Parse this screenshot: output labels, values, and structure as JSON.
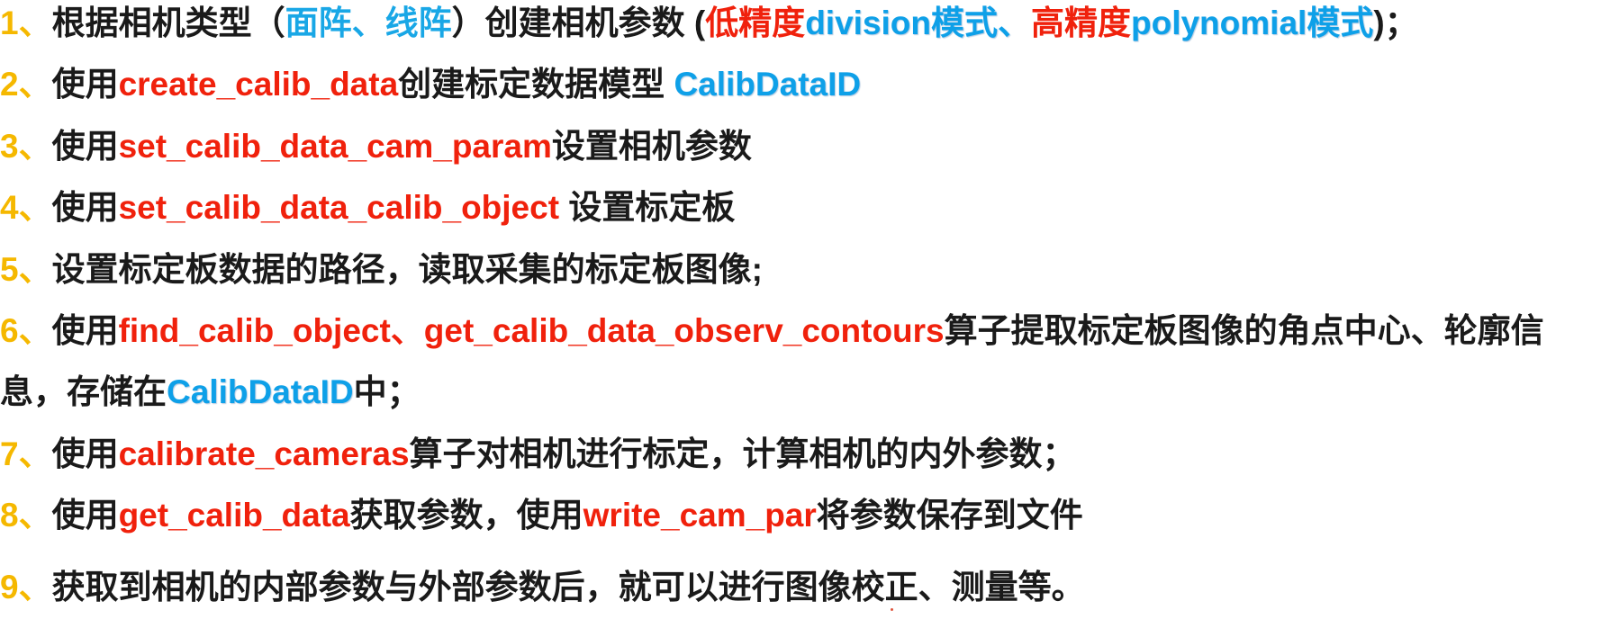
{
  "colors": {
    "number": "#f5b800",
    "text": "#1a1a1a",
    "operator": "#f0210c",
    "identifier": "#0ea0e8"
  },
  "steps": [
    {
      "segments": [
        {
          "text": "1、",
          "style": "num"
        },
        {
          "text": "根据相机类型（",
          "style": "text"
        },
        {
          "text": "面阵、线阵",
          "style": "cyan"
        },
        {
          "text": "）创建相机参数 (",
          "style": "text"
        },
        {
          "text": "低精度",
          "style": "red"
        },
        {
          "text": "division模式、",
          "style": "blue"
        },
        {
          "text": "高精度",
          "style": "red"
        },
        {
          "text": "polynomial模式",
          "style": "blue"
        },
        {
          "text": ")；",
          "style": "text"
        }
      ]
    },
    {
      "segments": [
        {
          "text": "2、",
          "style": "num"
        },
        {
          "text": "使用",
          "style": "text"
        },
        {
          "text": "create_calib_data",
          "style": "red"
        },
        {
          "text": "创建标定数据模型 ",
          "style": "text"
        },
        {
          "text": "CalibDataID",
          "style": "blue"
        }
      ]
    },
    {
      "segments": [
        {
          "text": "3、",
          "style": "num"
        },
        {
          "text": "使用",
          "style": "text"
        },
        {
          "text": "set_calib_data_cam_param",
          "style": "red"
        },
        {
          "text": "设置相机参数",
          "style": "text"
        }
      ]
    },
    {
      "segments": [
        {
          "text": "4、",
          "style": "num"
        },
        {
          "text": "使用",
          "style": "text"
        },
        {
          "text": "set_calib_data_calib_object",
          "style": "red"
        },
        {
          "text": " 设置标定板",
          "style": "text"
        }
      ]
    },
    {
      "segments": [
        {
          "text": "5、",
          "style": "num"
        },
        {
          "text": "设置标定板数据的路径，读取采集的标定板图像;",
          "style": "text"
        }
      ]
    },
    {
      "segments": [
        {
          "text": "6、",
          "style": "num"
        },
        {
          "text": "使用",
          "style": "text"
        },
        {
          "text": "find_calib_object、get_calib_data_observ_contours",
          "style": "red"
        },
        {
          "text": "算子提取标定板图像的角点中心、轮廓信",
          "style": "text"
        }
      ]
    },
    {
      "segments": [
        {
          "text": "息，存储在",
          "style": "text"
        },
        {
          "text": "CalibDataID",
          "style": "blue"
        },
        {
          "text": "中；",
          "style": "text"
        }
      ]
    },
    {
      "segments": [
        {
          "text": "7、",
          "style": "num"
        },
        {
          "text": "使用",
          "style": "text"
        },
        {
          "text": "calibrate_cameras",
          "style": "red"
        },
        {
          "text": "算子对相机进行标定，计算相机的内外参数；",
          "style": "text"
        }
      ]
    },
    {
      "segments": [
        {
          "text": "8、",
          "style": "num"
        },
        {
          "text": "使用",
          "style": "text"
        },
        {
          "text": "get_calib_data",
          "style": "red"
        },
        {
          "text": "获取参数，使用",
          "style": "text"
        },
        {
          "text": "write_cam_par",
          "style": "red"
        },
        {
          "text": "将参数保存到文件",
          "style": "text"
        }
      ]
    },
    {
      "segments": [
        {
          "text": "9、",
          "style": "num"
        },
        {
          "text": "获取到相机的内部参数与外部参数后，就可以进行图像校正、测量等。",
          "style": "text"
        }
      ]
    }
  ]
}
